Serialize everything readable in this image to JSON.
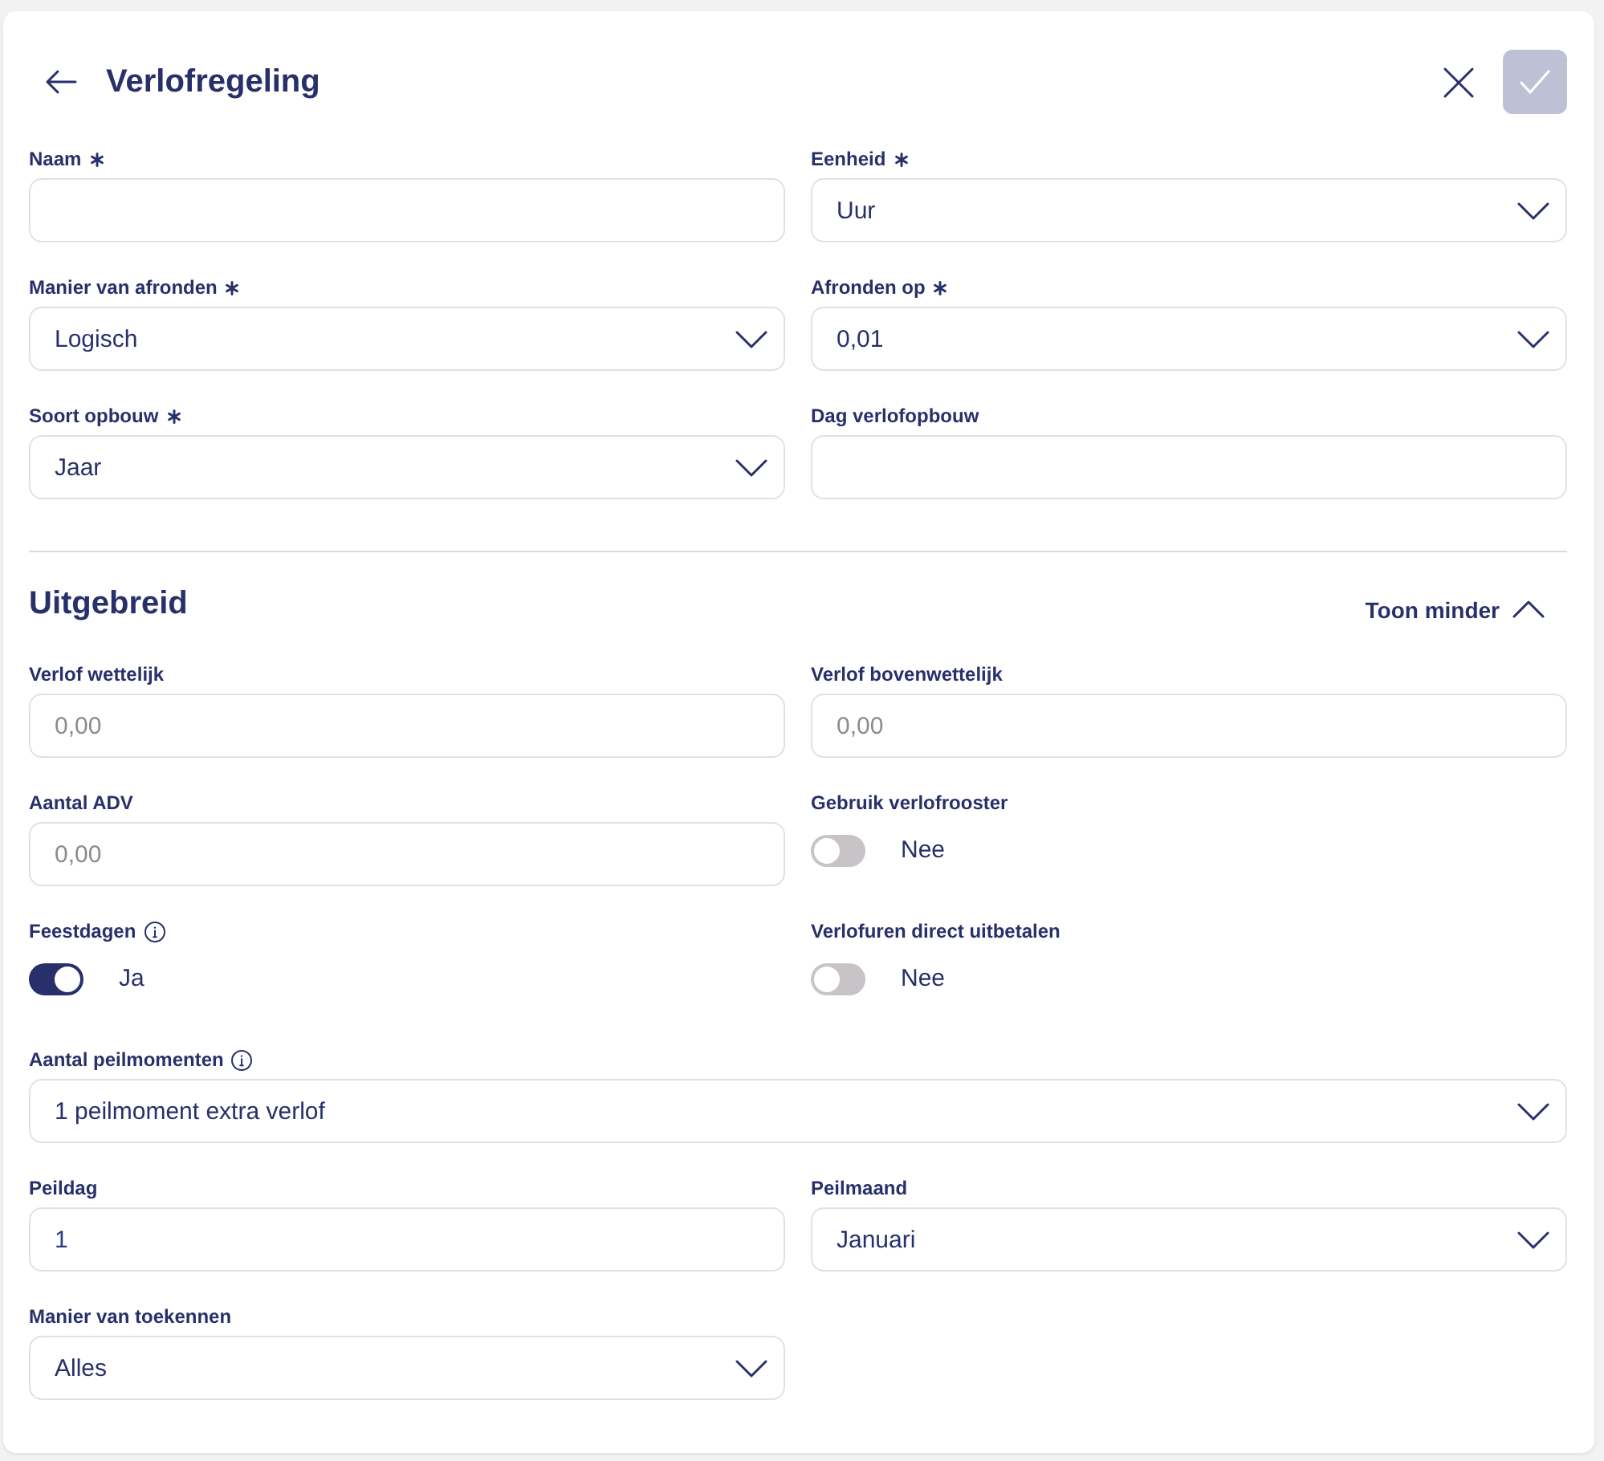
{
  "header": {
    "title": "Verlofregeling",
    "confirm_button": {
      "disabled": true
    }
  },
  "fields": [
    {
      "kind": "text",
      "label": "Naam",
      "required": true,
      "info": false
    },
    {
      "kind": "select",
      "label": "Eenheid",
      "required": true,
      "info": false,
      "value": "Uur"
    },
    {
      "kind": "select",
      "label": "Manier van afronden",
      "required": true,
      "info": false,
      "value": "Logisch"
    },
    {
      "kind": "select",
      "label": "Afronden op",
      "required": true,
      "info": false,
      "value": "0,01"
    },
    {
      "kind": "select",
      "label": "Soort opbouw",
      "required": true,
      "info": false,
      "value": "Jaar"
    },
    {
      "kind": "text",
      "label": "Dag verlofopbouw",
      "required": false,
      "info": false
    }
  ],
  "advanced": {
    "title": "Uitgebreid",
    "toggle_label": "Toon minder",
    "expanded": true,
    "fields": [
      {
        "kind": "text",
        "label": "Verlof wettelijk",
        "required": false,
        "info": false,
        "placeholder": "0,00"
      },
      {
        "kind": "text",
        "label": "Verlof bovenwettelijk",
        "required": false,
        "info": false,
        "placeholder": "0,00"
      },
      {
        "kind": "text",
        "label": "Aantal ADV",
        "required": false,
        "info": false,
        "placeholder": "0,00"
      },
      {
        "kind": "toggle",
        "label": "Gebruik verlofrooster",
        "required": false,
        "info": false,
        "on": false,
        "state_text": "Nee"
      },
      {
        "kind": "toggle",
        "label": "Feestdagen",
        "required": false,
        "info": true,
        "on": true,
        "state_text": "Ja"
      },
      {
        "kind": "toggle",
        "label": "Verlofuren direct uitbetalen",
        "required": false,
        "info": false,
        "on": false,
        "state_text": "Nee"
      },
      {
        "kind": "select",
        "label": "Aantal peilmomenten",
        "required": false,
        "info": true,
        "wide": true,
        "value": "1 peilmoment extra verlof"
      },
      {
        "kind": "text",
        "label": "Peildag",
        "required": false,
        "info": false,
        "value": "1"
      },
      {
        "kind": "select",
        "label": "Peilmaand",
        "required": false,
        "info": false,
        "value": "Januari"
      },
      {
        "kind": "select",
        "label": "Manier van toekennen",
        "required": false,
        "info": false,
        "value": "Alles"
      }
    ]
  }
}
